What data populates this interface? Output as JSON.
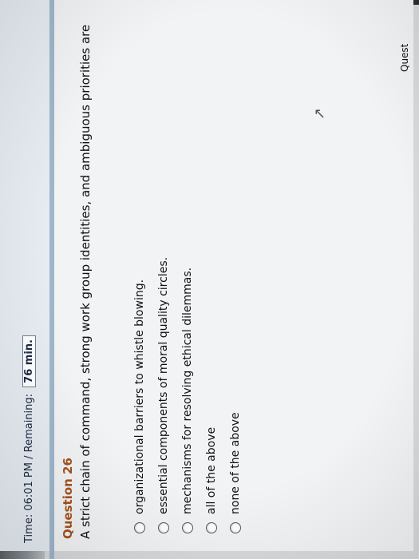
{
  "timer": {
    "label": "Time: 06:01 PM / Remaining:",
    "remaining": "76 min."
  },
  "question": {
    "title": "Question 26",
    "text": "A strict chain of command, strong work group identities, and ambiguous priorities are",
    "options": [
      "organizational barriers to whistle blowing.",
      "essential components of moral quality circles.",
      "mechanisms for resolving ethical dilemmas.",
      "all of the above",
      "none of the above"
    ]
  },
  "footer": {
    "partial_label": "Quest"
  }
}
